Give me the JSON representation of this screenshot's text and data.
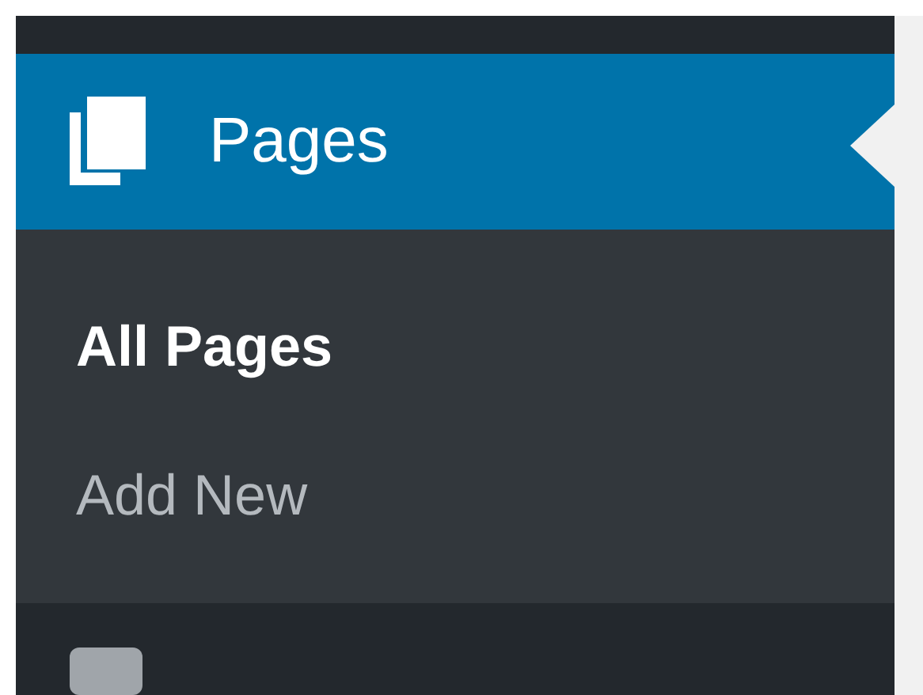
{
  "menu": {
    "label": "Pages",
    "selected": true,
    "submenu": [
      {
        "label": "All Pages",
        "selected": true
      },
      {
        "label": "Add New",
        "selected": false
      }
    ]
  }
}
